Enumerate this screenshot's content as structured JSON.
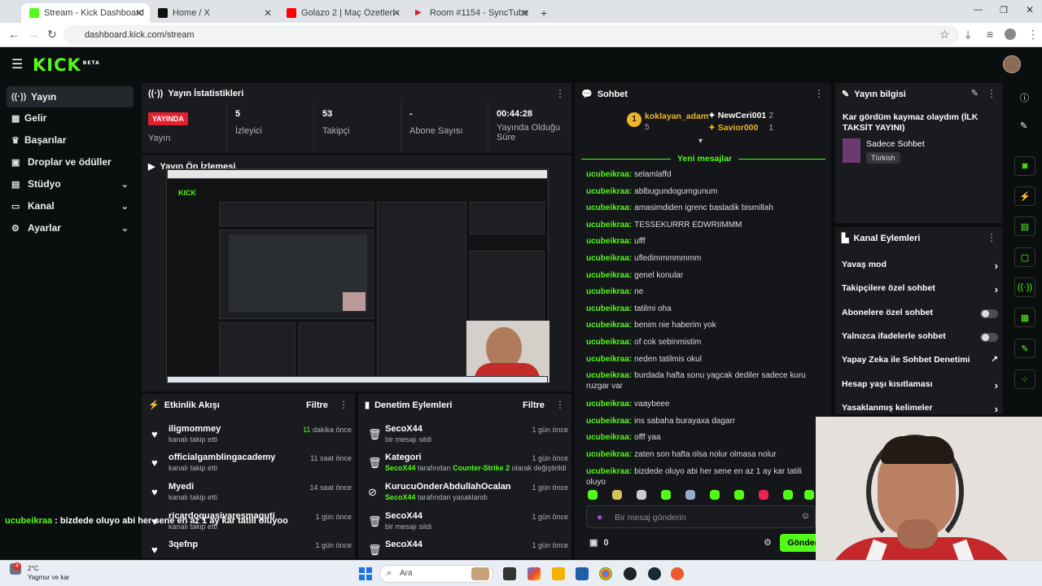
{
  "browser": {
    "tabs": [
      {
        "title": "Stream - Kick Dashboard",
        "color": "#53fc18",
        "active": true
      },
      {
        "title": "Home / X",
        "color": "#111111",
        "active": false
      },
      {
        "title": "Golazo 2 | Maç Özetleri - YouTu",
        "color": "#ff0000",
        "active": false
      },
      {
        "title": "Room #1154 - SyncTube",
        "color": "#d2232a",
        "active": false
      }
    ],
    "url": "dashboard.kick.com/stream"
  },
  "brand": {
    "logo": "KICK",
    "logo_tag": "BETA",
    "accent": "#53fc18"
  },
  "sidebar": {
    "items": [
      {
        "label": "Yayın",
        "icon": "broadcast-icon",
        "active": true
      },
      {
        "label": "Gelir",
        "icon": "chart-icon"
      },
      {
        "label": "Başarılar",
        "icon": "trophy-icon"
      },
      {
        "label": "Droplar ve ödüller",
        "icon": "gift-icon"
      },
      {
        "label": "Stüdyo",
        "icon": "studio-icon",
        "chevron": true
      },
      {
        "label": "Kanal",
        "icon": "channel-icon",
        "chevron": true
      },
      {
        "label": "Ayarlar",
        "icon": "gear-icon",
        "chevron": true
      }
    ]
  },
  "stats": {
    "title": "Yayın İstatistikleri",
    "live_badge": "YAYINDA",
    "live_label": "Yayın",
    "cells": [
      {
        "value": "5",
        "label": "İzleyici"
      },
      {
        "value": "53",
        "label": "Takipçi"
      },
      {
        "value": "-",
        "label": "Abone Sayısı"
      },
      {
        "value": "00:44:28",
        "label": "Yayında Olduğu Süre"
      }
    ]
  },
  "preview": {
    "title": "Yayın Ön İzlemesi"
  },
  "activity": {
    "title": "Etkinlik Akışı",
    "filter": "Filtre",
    "items": [
      {
        "name": "iligmommey",
        "sub": "kanalı takip etti",
        "time_num": "11",
        "time": "dakika önce"
      },
      {
        "name": "officialgamblingacademy",
        "sub": "kanalı takip etti",
        "time_num": "",
        "time": "11 saat önce"
      },
      {
        "name": "Myedi",
        "sub": "kanalı takip etti",
        "time_num": "",
        "time": "14 saat önce"
      },
      {
        "name": "ricardoquasivaresmaguti",
        "sub": "kanalı takip etti",
        "time_num": "",
        "time": "1 gün önce"
      },
      {
        "name": "3qefnp",
        "sub": "",
        "time_num": "",
        "time": "1 gün önce"
      }
    ]
  },
  "moderation": {
    "title": "Denetim Eylemleri",
    "filter": "Filtre",
    "items": [
      {
        "name": "SecoX44",
        "sub": "bir mesajı sildi",
        "time": "1 gün önce",
        "icon": "trash-icon"
      },
      {
        "name": "Kategori",
        "sub_user": "SecoX44",
        "sub_mid": " tarafından ",
        "sub_hl": "Counter-Strike 2",
        "sub_end": " olarak değiştirildi",
        "time": "1 gün önce",
        "icon": "trash-icon"
      },
      {
        "name": "KurucuOnderAbdullahOcalan",
        "sub_user": "SecoX44",
        "sub_mid": " tarafından yasaklandı",
        "time": "1 gün önce",
        "icon": "ban-icon"
      },
      {
        "name": "SecoX44",
        "sub": "bir mesajı sildi",
        "time": "1 gün önce",
        "icon": "trash-icon"
      },
      {
        "name": "SecoX44",
        "sub": "",
        "time": "1 gün önce",
        "icon": "trash-icon"
      }
    ]
  },
  "chat": {
    "title": "Sohbet",
    "leaders": [
      {
        "rank": "1",
        "name": "koklayan_adam",
        "count": "5"
      },
      {
        "name": "NewCeri001",
        "count": "2"
      },
      {
        "name": "Savior000",
        "count": "1"
      }
    ],
    "new_messages": "Yeni mesajlar",
    "messages": [
      {
        "user": "ucubeikraa:",
        "text": "selamlaffd"
      },
      {
        "user": "ucubeikraa:",
        "text": "ablbugundogumgunum"
      },
      {
        "user": "ucubeikraa:",
        "text": "amasimdiden igrenc basladik bismillah"
      },
      {
        "user": "ucubeikraa:",
        "text": "TESSEKURRR EDWRIIMMM"
      },
      {
        "user": "ucubeikraa:",
        "text": "ufff"
      },
      {
        "user": "ucubeikraa:",
        "text": "ufledimmmmmmm"
      },
      {
        "user": "ucubeikraa:",
        "text": "genel konular"
      },
      {
        "user": "ucubeikraa:",
        "text": "ne"
      },
      {
        "user": "ucubeikraa:",
        "text": "tatilmi oha"
      },
      {
        "user": "ucubeikraa:",
        "text": "benim nie haberim yok"
      },
      {
        "user": "ucubeikraa:",
        "text": "of cok sebinmistim"
      },
      {
        "user": "ucubeikraa:",
        "text": "neden tatilmis okul"
      },
      {
        "user": "ucubeikraa:",
        "text": "burdada hafta sonu yagcak dediler sadece kuru ruzgar var"
      },
      {
        "user": "ucubeikraa:",
        "text": "vaaybeee"
      },
      {
        "user": "ucubeikraa:",
        "text": "ins sabaha burayaxa dagarr"
      },
      {
        "user": "ucubeikraa:",
        "text": "offf yaa"
      },
      {
        "user": "ucubeikraa:",
        "text": "zaten son hafta olsa nolur olmasa nolur"
      },
      {
        "user": "ucubeikraa:",
        "text": "bizdede oluyo abi her sene en az 1 ay kar tatili oluyo"
      }
    ],
    "input_placeholder": "Bir mesaj gönderin",
    "points": "0",
    "send_label": "Gönder"
  },
  "stream_info": {
    "title": "Yayın bilgisi",
    "stream_title": "Kar gördüm kaymaz olaydım (İLK TAKSİT YAYINI)",
    "category": "Sadece Sohbet",
    "language": "Türkish"
  },
  "channel_actions": {
    "title": "Kanal Eylemleri",
    "items": [
      {
        "label": "Yavaş mod",
        "control": "arrow"
      },
      {
        "label": "Takipçilere özel sohbet",
        "control": "arrow"
      },
      {
        "label": "Abonelere özel sohbet",
        "control": "toggle"
      },
      {
        "label": "Yalnızca ifadelerle sohbet",
        "control": "toggle"
      },
      {
        "label": "Yapay Zeka ile Sohbet Denetimi",
        "control": "external"
      },
      {
        "label": "Hesap yaşı kısıtlaması",
        "control": "arrow"
      },
      {
        "label": "Yasaklanmış kelimeler",
        "control": "arrow"
      }
    ]
  },
  "overlay": {
    "user": "ucubeikraa",
    "text": " : bizdede oluyo abi her sene en az 1 ay kar tatili oluyoo"
  },
  "taskbar": {
    "weather_temp": "2°C",
    "weather_text": "Yagmur ve kar",
    "search": "Ara",
    "notif_count": "4"
  }
}
